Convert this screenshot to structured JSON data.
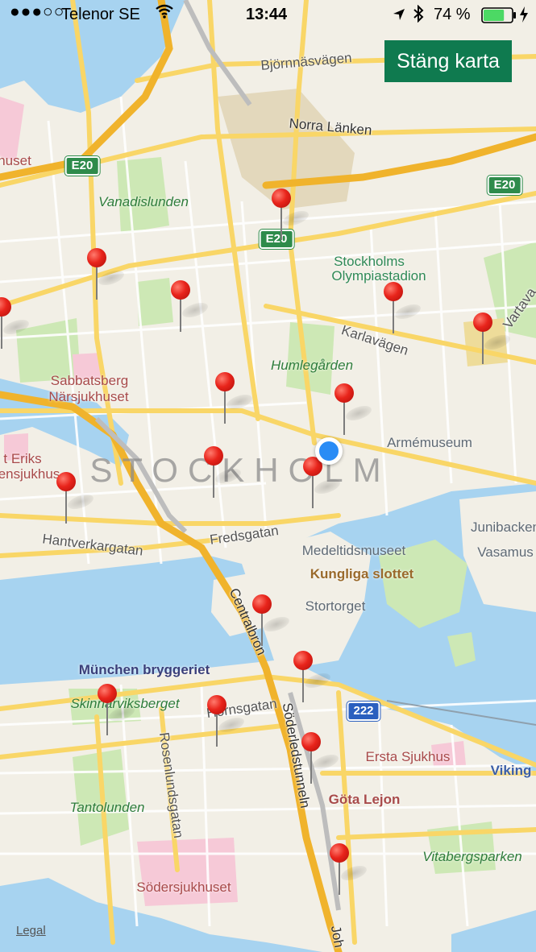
{
  "status_bar": {
    "carrier": "Telenor SE",
    "time": "13:44",
    "battery_percent": "74 %",
    "battery_level": 0.74,
    "signal_icon": "signal-dots-icon",
    "wifi_icon": "wifi-icon",
    "location_icon": "location-arrow-icon",
    "bluetooth_icon": "bluetooth-icon",
    "charging_icon": "charging-bolt-icon"
  },
  "toolbar": {
    "close_map_label": "Stäng karta"
  },
  "map": {
    "city_label": "STOCKHOLM",
    "legal_label": "Legal",
    "colors": {
      "land": "#f2efe6",
      "water": "#a7d3f0",
      "park": "#cde8b5",
      "road": "#f9d667",
      "hospital": "#f6c9d7",
      "highway": "#f0b32c"
    },
    "road_labels": [
      "Björnnäsvägen",
      "Norra Länken",
      "Karlavägen",
      "Fredsgatan",
      "Hantverkargatan",
      "Centralbron",
      "Hornsgatan",
      "Rosenlundsgatan",
      "Söderledstunneln",
      "Vartava",
      "Joh"
    ],
    "park_labels": [
      "Vanadislunden",
      "Humlegården",
      "Skinnarviksberget",
      "Tantolunden",
      "Vitabergsparken"
    ],
    "hospital_labels": [
      "Sabbatsberg",
      "Närsjukhuset",
      "Ersta Sjukhus",
      "Södersjukhuset",
      "huset",
      "t Eriks",
      "ensjukhus"
    ],
    "poi_labels": [
      "Armémuseum",
      "Stortorget",
      "Medeltidsmuseet",
      "Kungliga slottet",
      "Junibacken",
      "Vasamus",
      "Viking",
      "München bryggeriet",
      "Göta Lejon",
      "Stockholms",
      "Olympiastadion"
    ],
    "shields": [
      "E20",
      "E20",
      "E20",
      "222"
    ],
    "pin_count": 17
  }
}
